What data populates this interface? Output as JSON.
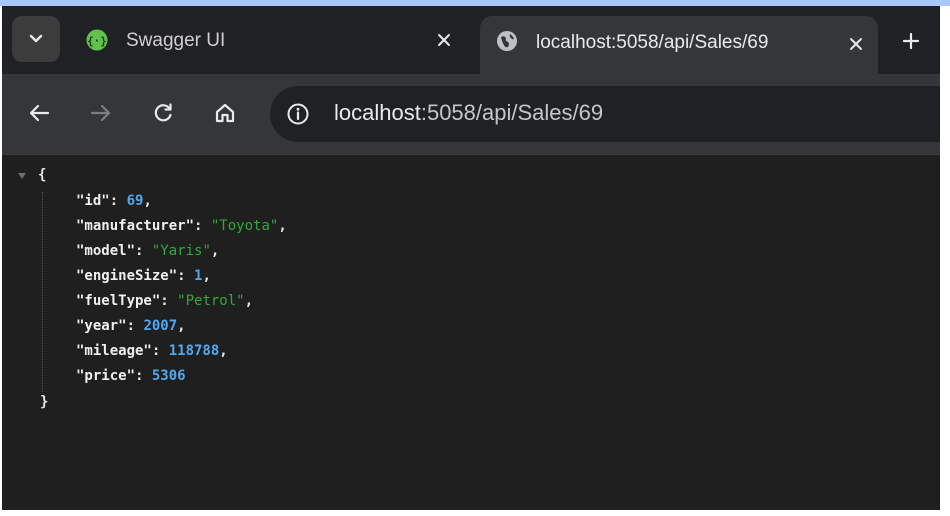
{
  "browser": {
    "tabs": [
      {
        "title": "Swagger UI",
        "favicon": "swagger-icon",
        "active": false
      },
      {
        "title": "localhost:5058/api/Sales/69",
        "favicon": "globe-icon",
        "active": true
      }
    ],
    "address": {
      "host": "localhost",
      "rest": ":5058/api/Sales/69"
    },
    "icons": {
      "tab_menu": "chevron-down-icon",
      "close": "close-icon",
      "new_tab": "plus-icon",
      "back": "arrow-left-icon",
      "forward": "arrow-right-icon",
      "reload": "reload-icon",
      "home": "home-icon",
      "site_info": "info-icon"
    },
    "colors": {
      "json_key": "#f0f0f0",
      "json_number": "#4fa8f0",
      "json_string": "#2eaa3a"
    }
  },
  "json": {
    "open": "{",
    "close": "}",
    "fields": [
      {
        "key": "\"id\"",
        "value": "69",
        "type": "number",
        "comma": ","
      },
      {
        "key": "\"manufacturer\"",
        "value": "\"Toyota\"",
        "type": "string",
        "comma": ","
      },
      {
        "key": "\"model\"",
        "value": "\"Yaris\"",
        "type": "string",
        "comma": ","
      },
      {
        "key": "\"engineSize\"",
        "value": "1",
        "type": "number",
        "comma": ","
      },
      {
        "key": "\"fuelType\"",
        "value": "\"Petrol\"",
        "type": "string",
        "comma": ","
      },
      {
        "key": "\"year\"",
        "value": "2007",
        "type": "number",
        "comma": ","
      },
      {
        "key": "\"mileage\"",
        "value": "118788",
        "type": "number",
        "comma": ","
      },
      {
        "key": "\"price\"",
        "value": "5306",
        "type": "number",
        "comma": ""
      }
    ]
  }
}
